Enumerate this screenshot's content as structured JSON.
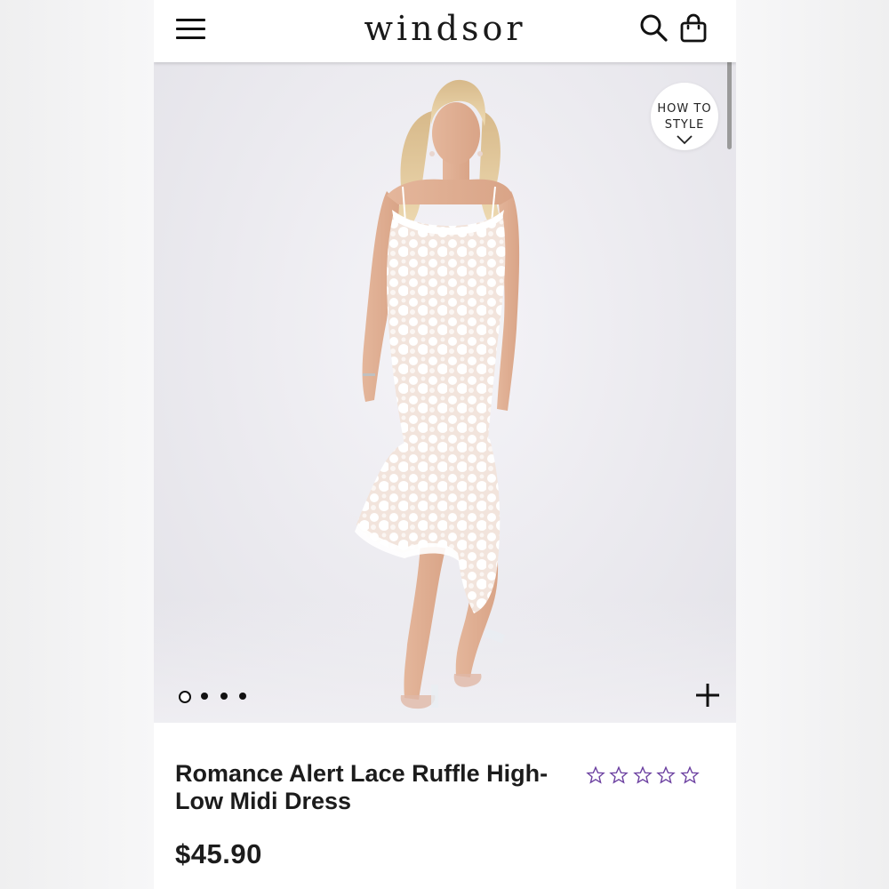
{
  "header": {
    "logo": "WINDSOR",
    "icons": {
      "menu": "hamburger-menu-icon",
      "search": "search-icon",
      "bag": "shopping-bag-icon"
    }
  },
  "hero": {
    "how_to_style": {
      "line1": "HOW TO",
      "line2": "STYLE",
      "icon": "chevron-down-icon"
    },
    "carousel": {
      "count": 4,
      "active_index": 0
    },
    "zoom_icon": "plus-icon"
  },
  "product": {
    "title": "Romance Alert Lace Ruffle High-Low Midi Dress",
    "price": "$45.90",
    "rating": {
      "stars_filled": 0,
      "stars_total": 5,
      "color": "#6b3fa0"
    }
  },
  "colors": {
    "text": "#1c1c1c",
    "star": "#6b3fa0",
    "background": "#ebeaef"
  }
}
